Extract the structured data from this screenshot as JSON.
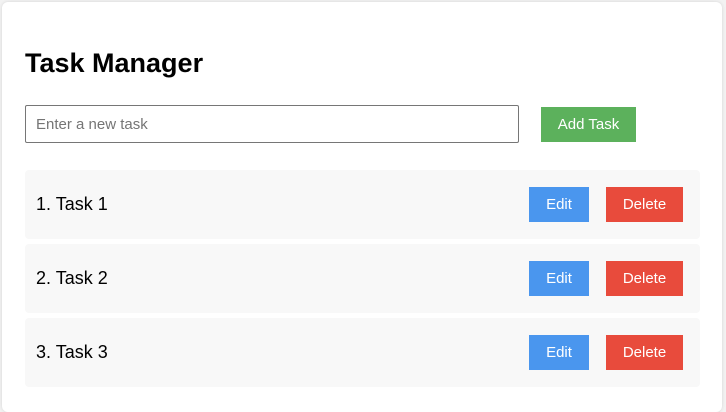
{
  "app": {
    "title": "Task Manager"
  },
  "new_task": {
    "placeholder": "Enter a new task",
    "value": "",
    "add_label": "Add Task"
  },
  "tasks": [
    {
      "label": "1. Task 1",
      "edit_label": "Edit",
      "delete_label": "Delete"
    },
    {
      "label": "2. Task 2",
      "edit_label": "Edit",
      "delete_label": "Delete"
    },
    {
      "label": "3. Task 3",
      "edit_label": "Edit",
      "delete_label": "Delete"
    }
  ],
  "colors": {
    "add_button": "#5cb15c",
    "edit_button": "#4a96ee",
    "delete_button": "#e84b3c",
    "row_background": "#f8f8f8"
  }
}
